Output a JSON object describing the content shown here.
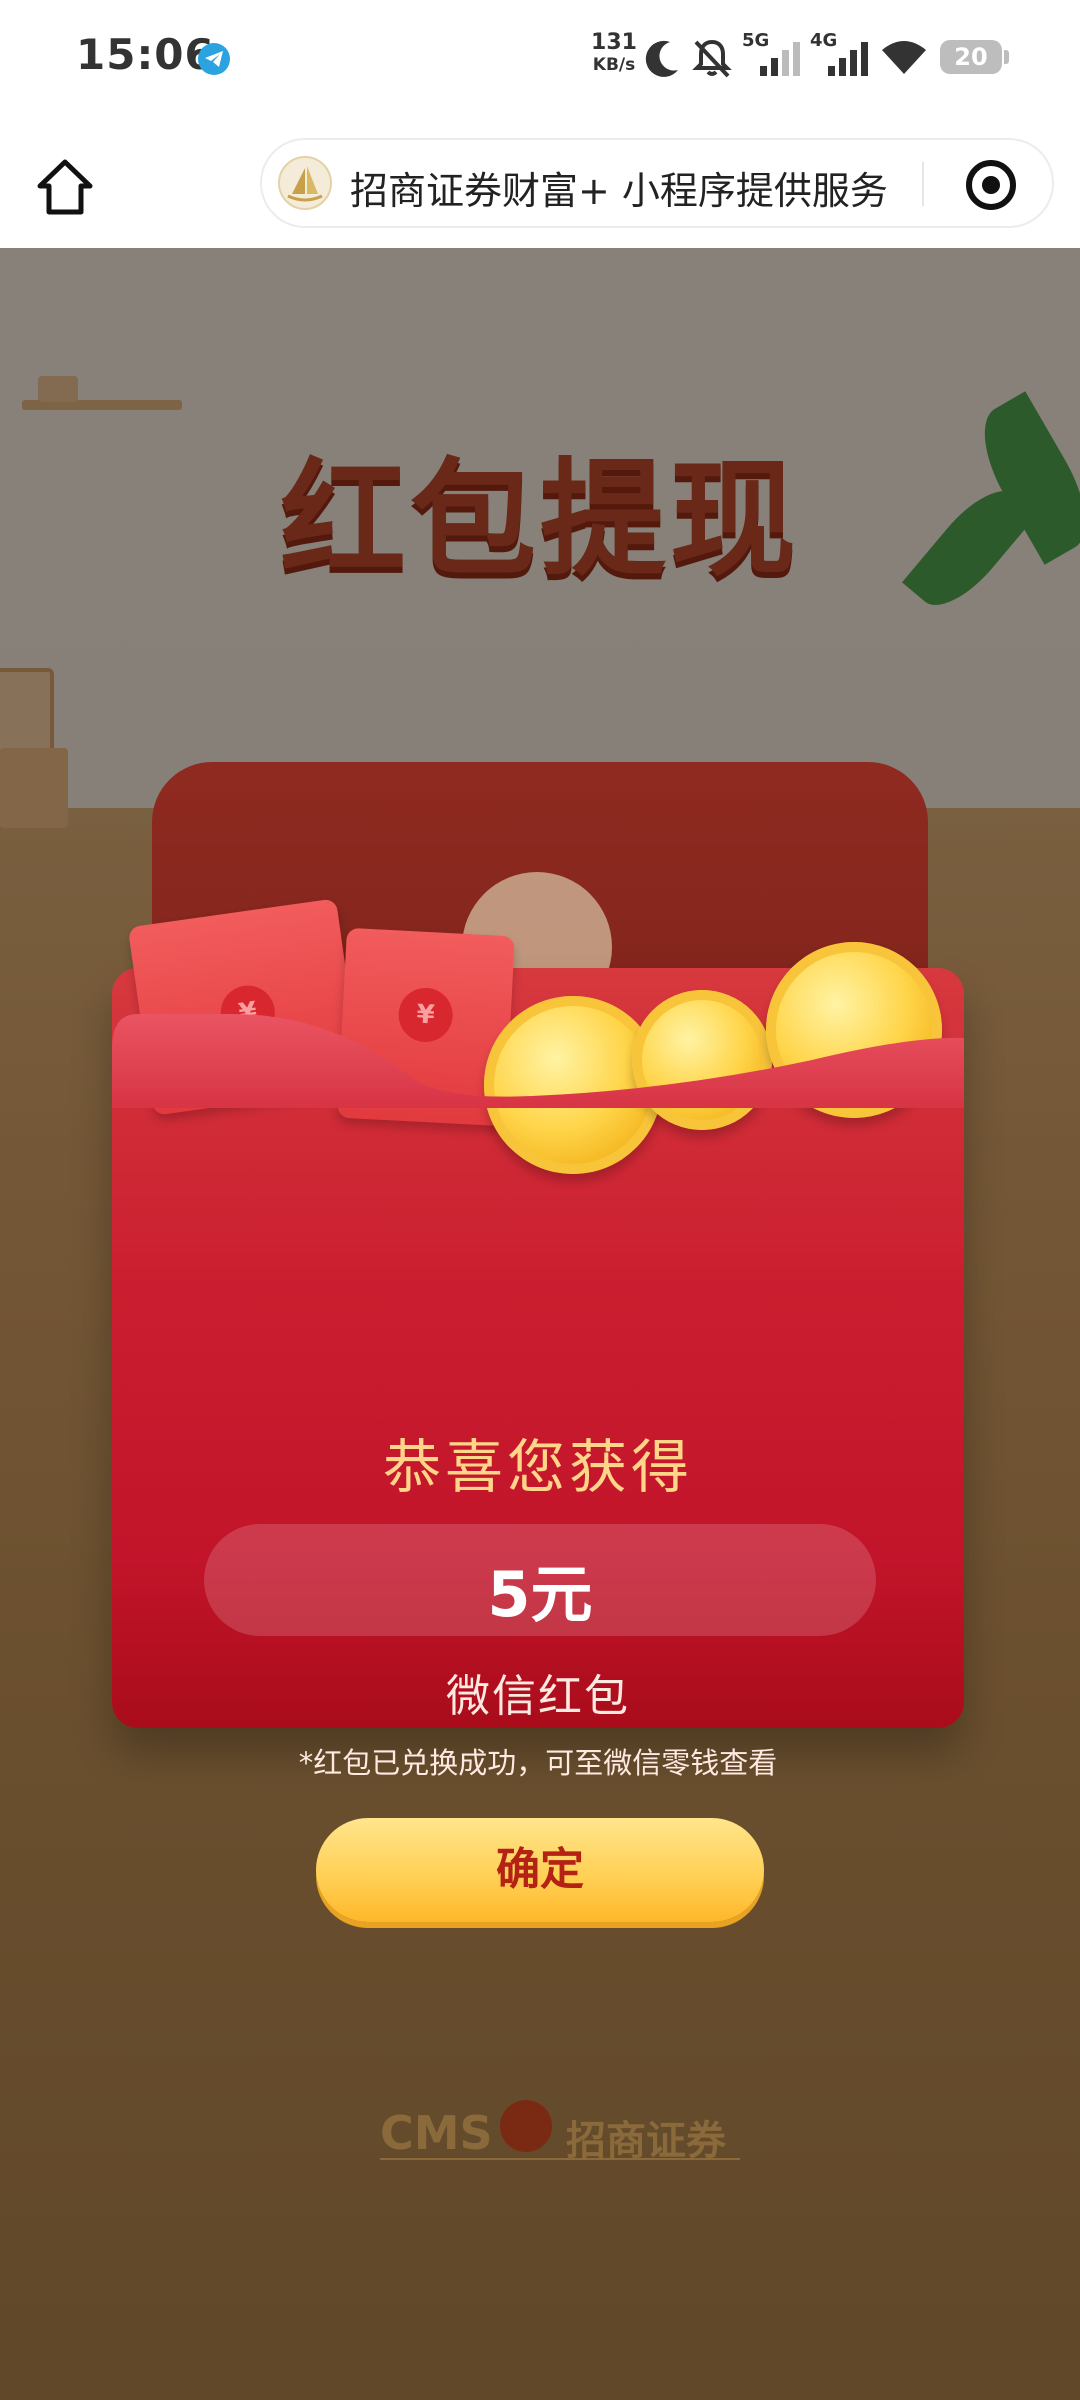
{
  "status_bar": {
    "time": "15:06",
    "net_speed_value": "131",
    "net_speed_unit": "KB/s",
    "signal_5g": "5G",
    "signal_4g": "4G",
    "battery": "20",
    "icons": [
      "telegram-icon",
      "moon-icon",
      "bell-muted-icon",
      "signal-5g-icon",
      "signal-4g-icon",
      "wifi-icon",
      "battery-icon"
    ]
  },
  "navbar": {
    "mini_program_title": "招商证券财富+ 小程序提供服务",
    "icons": [
      "home-icon",
      "target-icon"
    ]
  },
  "page": {
    "banner_title": "红包提现",
    "congrats": "恭喜您获得",
    "amount": "5元",
    "prize_type": "微信红包",
    "note": "*红包已兑换成功，可至微信零钱查看",
    "confirm_label": "确定",
    "envelope_symbol": "¥",
    "footer_logo_en": "CMS",
    "footer_logo_cn": "招商证券"
  },
  "colors": {
    "packet_red": "#cb1f30",
    "congrats_gold": "#ffd58a",
    "button_gold": "#ffd156",
    "button_text": "#b42215"
  }
}
